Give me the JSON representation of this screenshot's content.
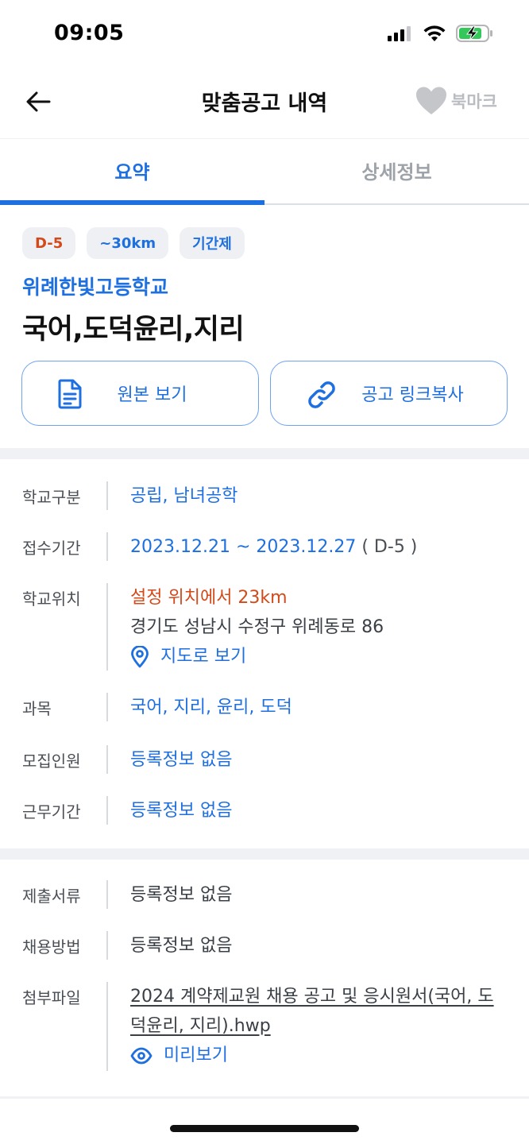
{
  "status_bar": {
    "time": "09:05"
  },
  "header": {
    "title": "맞춤공고 내역",
    "bookmark_label": "북마크"
  },
  "tabs": [
    {
      "label": "요약",
      "active": true
    },
    {
      "label": "상세정보",
      "active": false
    }
  ],
  "summary": {
    "badges": [
      "D-5",
      "~30km",
      "기간제"
    ],
    "school_name": "위례한빛고등학교",
    "job_title": "국어,도덕윤리,지리",
    "view_original_label": "원본 보기",
    "copy_link_label": "공고 링크복사"
  },
  "info": {
    "school_type": {
      "label": "학교구분",
      "value": "공립, 남녀공학"
    },
    "application_period": {
      "label": "접수기간",
      "value": "2023.12.21 ~ 2023.12.27",
      "dday": "( D-5 )"
    },
    "school_location": {
      "label": "학교위치",
      "distance": "설정 위치에서 23km",
      "address": "경기도 성남시 수정구 위례동로 86",
      "map_link": "지도로 보기"
    },
    "subjects": {
      "label": "과목",
      "value": "국어, 지리, 윤리, 도덕"
    },
    "recruit_count": {
      "label": "모집인원",
      "value": "등록정보 없음"
    },
    "work_period": {
      "label": "근무기간",
      "value": "등록정보 없음"
    }
  },
  "extra": {
    "documents": {
      "label": "제출서류",
      "value": "등록정보 없음"
    },
    "hiring_method": {
      "label": "채용방법",
      "value": "등록정보 없음"
    },
    "attachments": {
      "label": "첨부파일",
      "file_name": "2024 계약제교원 채용 공고 및 응시원서(국어,  도덕윤리,  지리).hwp",
      "preview_label": "미리보기"
    }
  },
  "colors": {
    "accent": "#1e6fe0",
    "dday": "#d4491a",
    "battery": "#34c759"
  }
}
